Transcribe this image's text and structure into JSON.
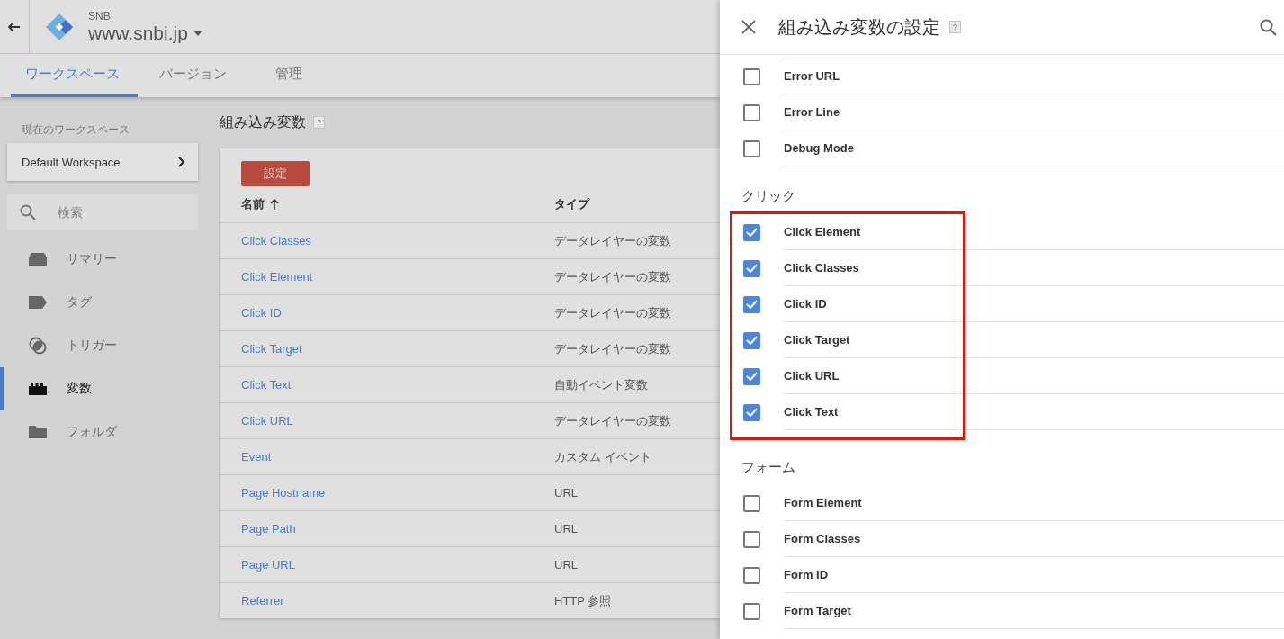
{
  "header": {
    "account": "SNBI",
    "container": "www.snbi.jp"
  },
  "tabs": [
    {
      "label": "ワークスペース",
      "selected": true
    },
    {
      "label": "バージョン",
      "selected": false
    },
    {
      "label": "管理",
      "selected": false
    }
  ],
  "sidebar": {
    "workspace_label": "現在のワークスペース",
    "workspace_name": "Default Workspace",
    "search_placeholder": "検索",
    "items": [
      {
        "label": "サマリー",
        "selected": false
      },
      {
        "label": "タグ",
        "selected": false
      },
      {
        "label": "トリガー",
        "selected": false
      },
      {
        "label": "変数",
        "selected": true
      },
      {
        "label": "フォルダ",
        "selected": false
      }
    ]
  },
  "main": {
    "title": "組み込み変数",
    "help": "?",
    "button": "設定",
    "columns": [
      "名前",
      "タイプ"
    ],
    "rows": [
      {
        "name": "Click Classes",
        "type": "データレイヤーの変数"
      },
      {
        "name": "Click Element",
        "type": "データレイヤーの変数"
      },
      {
        "name": "Click ID",
        "type": "データレイヤーの変数"
      },
      {
        "name": "Click Target",
        "type": "データレイヤーの変数"
      },
      {
        "name": "Click Text",
        "type": "自動イベント変数"
      },
      {
        "name": "Click URL",
        "type": "データレイヤーの変数"
      },
      {
        "name": "Event",
        "type": "カスタム イベント"
      },
      {
        "name": "Page Hostname",
        "type": "URL"
      },
      {
        "name": "Page Path",
        "type": "URL"
      },
      {
        "name": "Page URL",
        "type": "URL"
      },
      {
        "name": "Referrer",
        "type": "HTTP 参照"
      }
    ]
  },
  "panel": {
    "title": "組み込み変数の設定",
    "help": "?",
    "sections": [
      {
        "highlighted": false,
        "items": [
          {
            "label": "Error URL",
            "checked": false
          },
          {
            "label": "Error Line",
            "checked": false
          },
          {
            "label": "Debug Mode",
            "checked": false
          }
        ]
      },
      {
        "heading": "クリック",
        "highlighted": true,
        "items": [
          {
            "label": "Click Element",
            "checked": true
          },
          {
            "label": "Click Classes",
            "checked": true
          },
          {
            "label": "Click ID",
            "checked": true
          },
          {
            "label": "Click Target",
            "checked": true
          },
          {
            "label": "Click URL",
            "checked": true
          },
          {
            "label": "Click Text",
            "checked": true
          }
        ]
      },
      {
        "heading": "フォーム",
        "highlighted": false,
        "items": [
          {
            "label": "Form Element",
            "checked": false
          },
          {
            "label": "Form Classes",
            "checked": false
          },
          {
            "label": "Form ID",
            "checked": false
          },
          {
            "label": "Form Target",
            "checked": false
          }
        ]
      }
    ]
  }
}
